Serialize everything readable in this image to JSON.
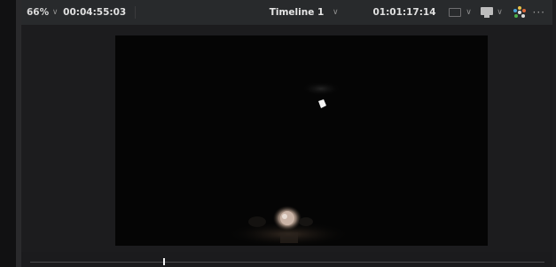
{
  "toolbar": {
    "zoom": "66%",
    "source_timecode": "00:04:55:03",
    "timeline_name": "Timeline 1",
    "record_timecode": "01:01:17:14",
    "more_label": "···"
  },
  "icons": {
    "zoom_dropdown": "chevron-down-icon",
    "timeline_dropdown": "chevron-down-icon",
    "viewer_mode": "monitor-icon",
    "output_display": "display-icon",
    "color_bypass": "color-wheel-icon",
    "more_options": "ellipsis-icon"
  },
  "colors": {
    "toolbar_bg": "#282a2c",
    "viewer_bg": "#1c1c1e",
    "frame_bg": "#050505",
    "playhead": "#f2f2f2"
  },
  "scrubber": {
    "playhead_position": 0.26
  }
}
